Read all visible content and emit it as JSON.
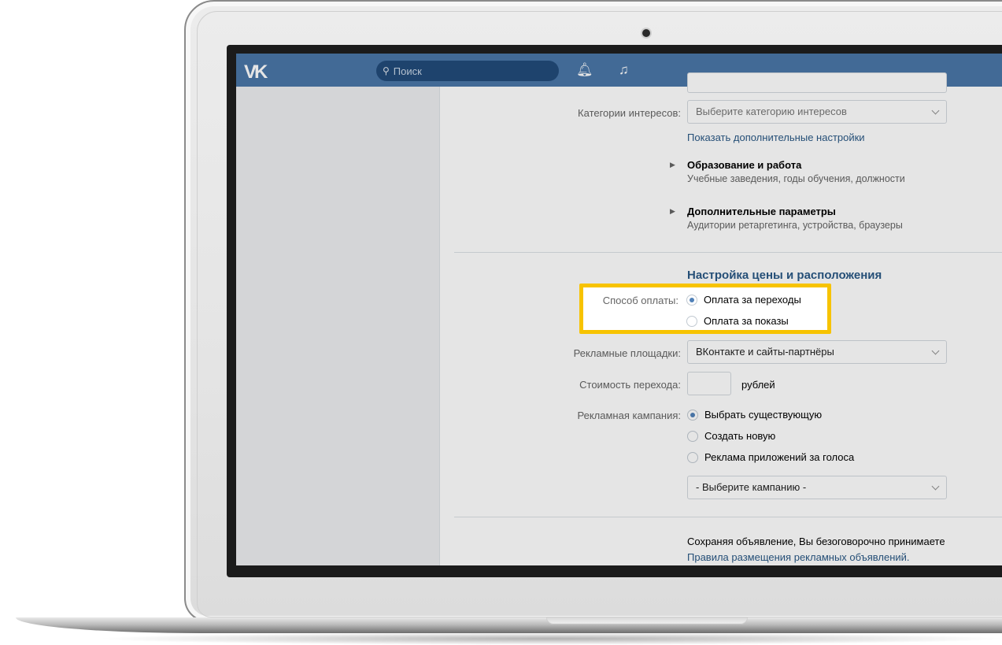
{
  "topbar": {
    "logo": "VK",
    "search_placeholder": "Поиск",
    "bell_icon": "bell-icon",
    "music_icon": "music-note-icon"
  },
  "form": {
    "interest_categories_label": "Категории интересов:",
    "interest_categories_value": "Выберите категорию интересов",
    "show_more_link": "Показать дополнительные настройки",
    "education": {
      "title": "Образование и работа",
      "subtitle": "Учебные заведения, годы обучения, должности"
    },
    "extra_params": {
      "title": "Дополнительные параметры",
      "subtitle": "Аудитории ретаргетинга, устройства, браузеры"
    },
    "price_section_title": "Настройка цены и расположения",
    "payment_label": "Способ оплаты:",
    "payment_options": [
      "Оплата за переходы",
      "Оплата за показы"
    ],
    "payment_selected": "Оплата за переходы",
    "ad_platforms_label": "Рекламные площадки:",
    "ad_platforms_value": "ВКонтакте и сайты-партнёры",
    "cost_label": "Стоимость перехода:",
    "cost_value": "",
    "cost_unit": "рублей",
    "campaign_label": "Рекламная кампания:",
    "campaign_options": [
      "Выбрать существующую",
      "Создать новую",
      "Реклама приложений за голоса"
    ],
    "campaign_selected": "Выбрать существующую",
    "campaign_select_value": "- Выберите кампанию -",
    "agreement_text": "Сохраняя объявление, Вы безоговорочно принимаете",
    "agreement_link": "Правила размещения рекламных объявлений."
  },
  "colors": {
    "topbar": "#4a76a8",
    "link": "#2a5885",
    "highlight": "#f7c300"
  }
}
